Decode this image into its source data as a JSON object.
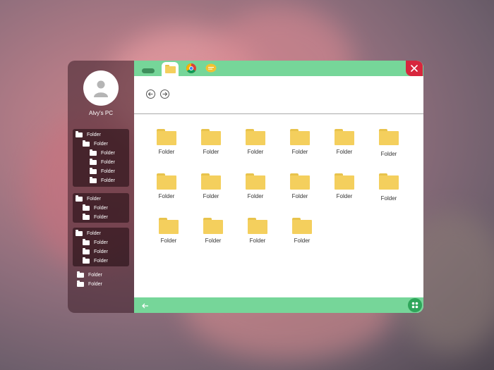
{
  "wallpaper": {
    "subject": "blurred pink flower",
    "accent": "#c9848a"
  },
  "sidebar": {
    "pc_name": "Alvy's PC",
    "groups": [
      {
        "items": [
          {
            "label": "Folder",
            "level": 0
          },
          {
            "label": "Folder",
            "level": 1
          },
          {
            "label": "Folder",
            "level": 2
          },
          {
            "label": "Folder",
            "level": 2
          },
          {
            "label": "Folder",
            "level": 2
          },
          {
            "label": "Folder",
            "level": 2
          }
        ]
      },
      {
        "items": [
          {
            "label": "Folder",
            "level": 0
          },
          {
            "label": "Folder",
            "level": 1
          },
          {
            "label": "Folder",
            "level": 1
          }
        ]
      },
      {
        "items": [
          {
            "label": "Folder",
            "level": 0
          },
          {
            "label": "Folder",
            "level": 1
          },
          {
            "label": "Folder",
            "level": 1
          },
          {
            "label": "Folder",
            "level": 1
          }
        ]
      },
      {
        "items": [
          {
            "label": "Folder",
            "level": 0
          },
          {
            "label": "Folder",
            "level": 0
          }
        ]
      }
    ]
  },
  "topbar": {
    "color": "#76d699",
    "tabs": [
      {
        "icon": "cloud-icon"
      },
      {
        "icon": "folder-icon",
        "active": true
      },
      {
        "icon": "chrome-icon"
      },
      {
        "icon": "chat-icon"
      }
    ],
    "close_color": "#d7263d"
  },
  "nav": {
    "back_icon": "arrow-left-circle-icon",
    "forward_icon": "arrow-right-circle-icon"
  },
  "content": {
    "folders": [
      {
        "label": "Folder"
      },
      {
        "label": "Folder"
      },
      {
        "label": "Folder"
      },
      {
        "label": "Folder"
      },
      {
        "label": "Folder"
      },
      {
        "label": "Folder"
      },
      {
        "label": "Folder"
      },
      {
        "label": "Folder"
      },
      {
        "label": "Folder"
      },
      {
        "label": "Folder"
      },
      {
        "label": "Folder"
      },
      {
        "label": "Folder"
      },
      {
        "label": "Folder"
      },
      {
        "label": "Folder"
      },
      {
        "label": "Folder"
      },
      {
        "label": "Folder"
      }
    ]
  },
  "bottombar": {
    "back_icon": "arrow-left-icon",
    "apps_icon": "apps-grid-icon"
  }
}
